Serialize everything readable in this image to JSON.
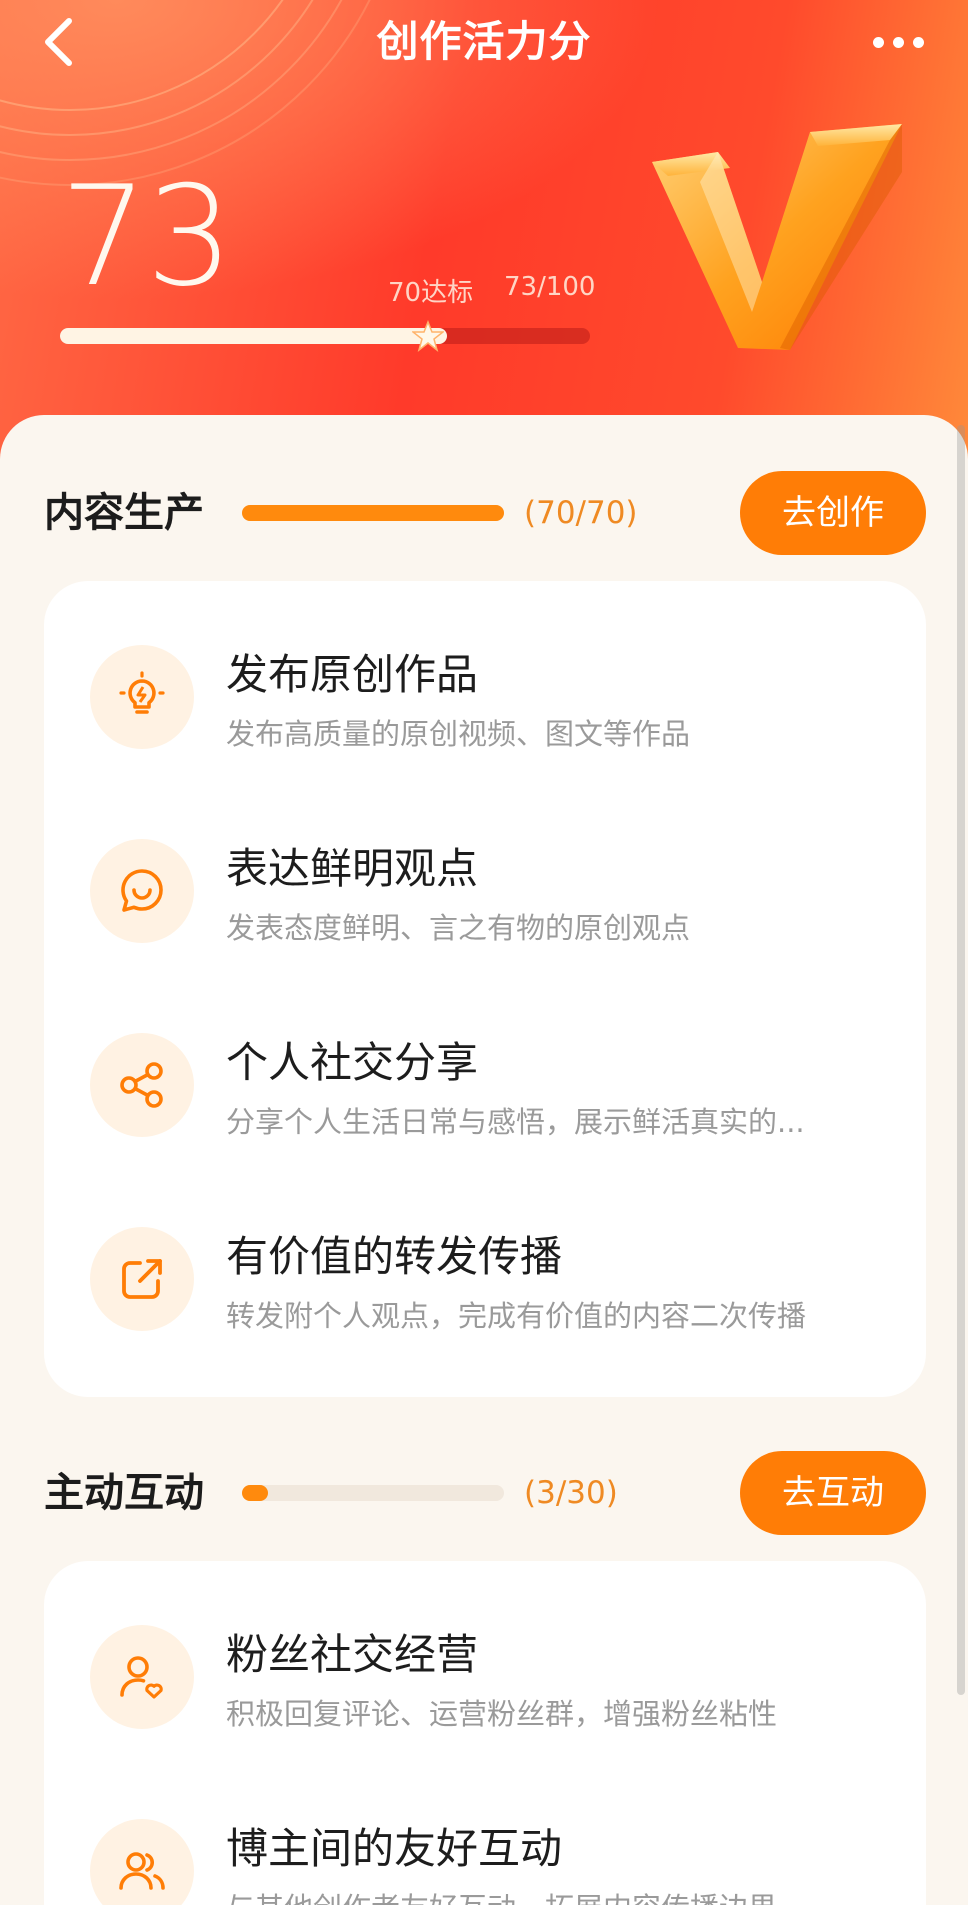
{
  "colors": {
    "accent": "#ff7d06",
    "hero_red": "#ff3a2a",
    "progress_text": "#ef8a23"
  },
  "nav": {
    "title": "创作活力分",
    "back_icon": "chevron-left-icon",
    "more_icon": "more-dots-icon"
  },
  "score": {
    "value": "73",
    "target_label": "70达标",
    "progress_label": "73/100",
    "fraction": 0.73
  },
  "sections": [
    {
      "title": "内容生产",
      "progress_text": "(70/70)",
      "progress_fraction": 1.0,
      "button_label": "去创作",
      "items": [
        {
          "icon": "lightbulb-icon",
          "title": "发布原创作品",
          "desc": "发布高质量的原创视频、图文等作品"
        },
        {
          "icon": "chat-smile-icon",
          "title": "表达鲜明观点",
          "desc": "发表态度鲜明、言之有物的原创观点"
        },
        {
          "icon": "share-icon",
          "title": "个人社交分享",
          "desc": "分享个人生活日常与感悟，展示鲜活真实的..."
        },
        {
          "icon": "forward-icon",
          "title": "有价值的转发传播",
          "desc": "转发附个人观点，完成有价值的内容二次传播"
        }
      ]
    },
    {
      "title": "主动互动",
      "progress_text": "(3/30)",
      "progress_fraction": 0.1,
      "button_label": "去互动",
      "items": [
        {
          "icon": "user-heart-icon",
          "title": "粉丝社交经营",
          "desc": "积极回复评论、运营粉丝群，增强粉丝粘性"
        },
        {
          "icon": "users-icon",
          "title": "博主间的友好互动",
          "desc": "与其他创作者友好互动，拓展内容传播边界"
        }
      ]
    }
  ]
}
